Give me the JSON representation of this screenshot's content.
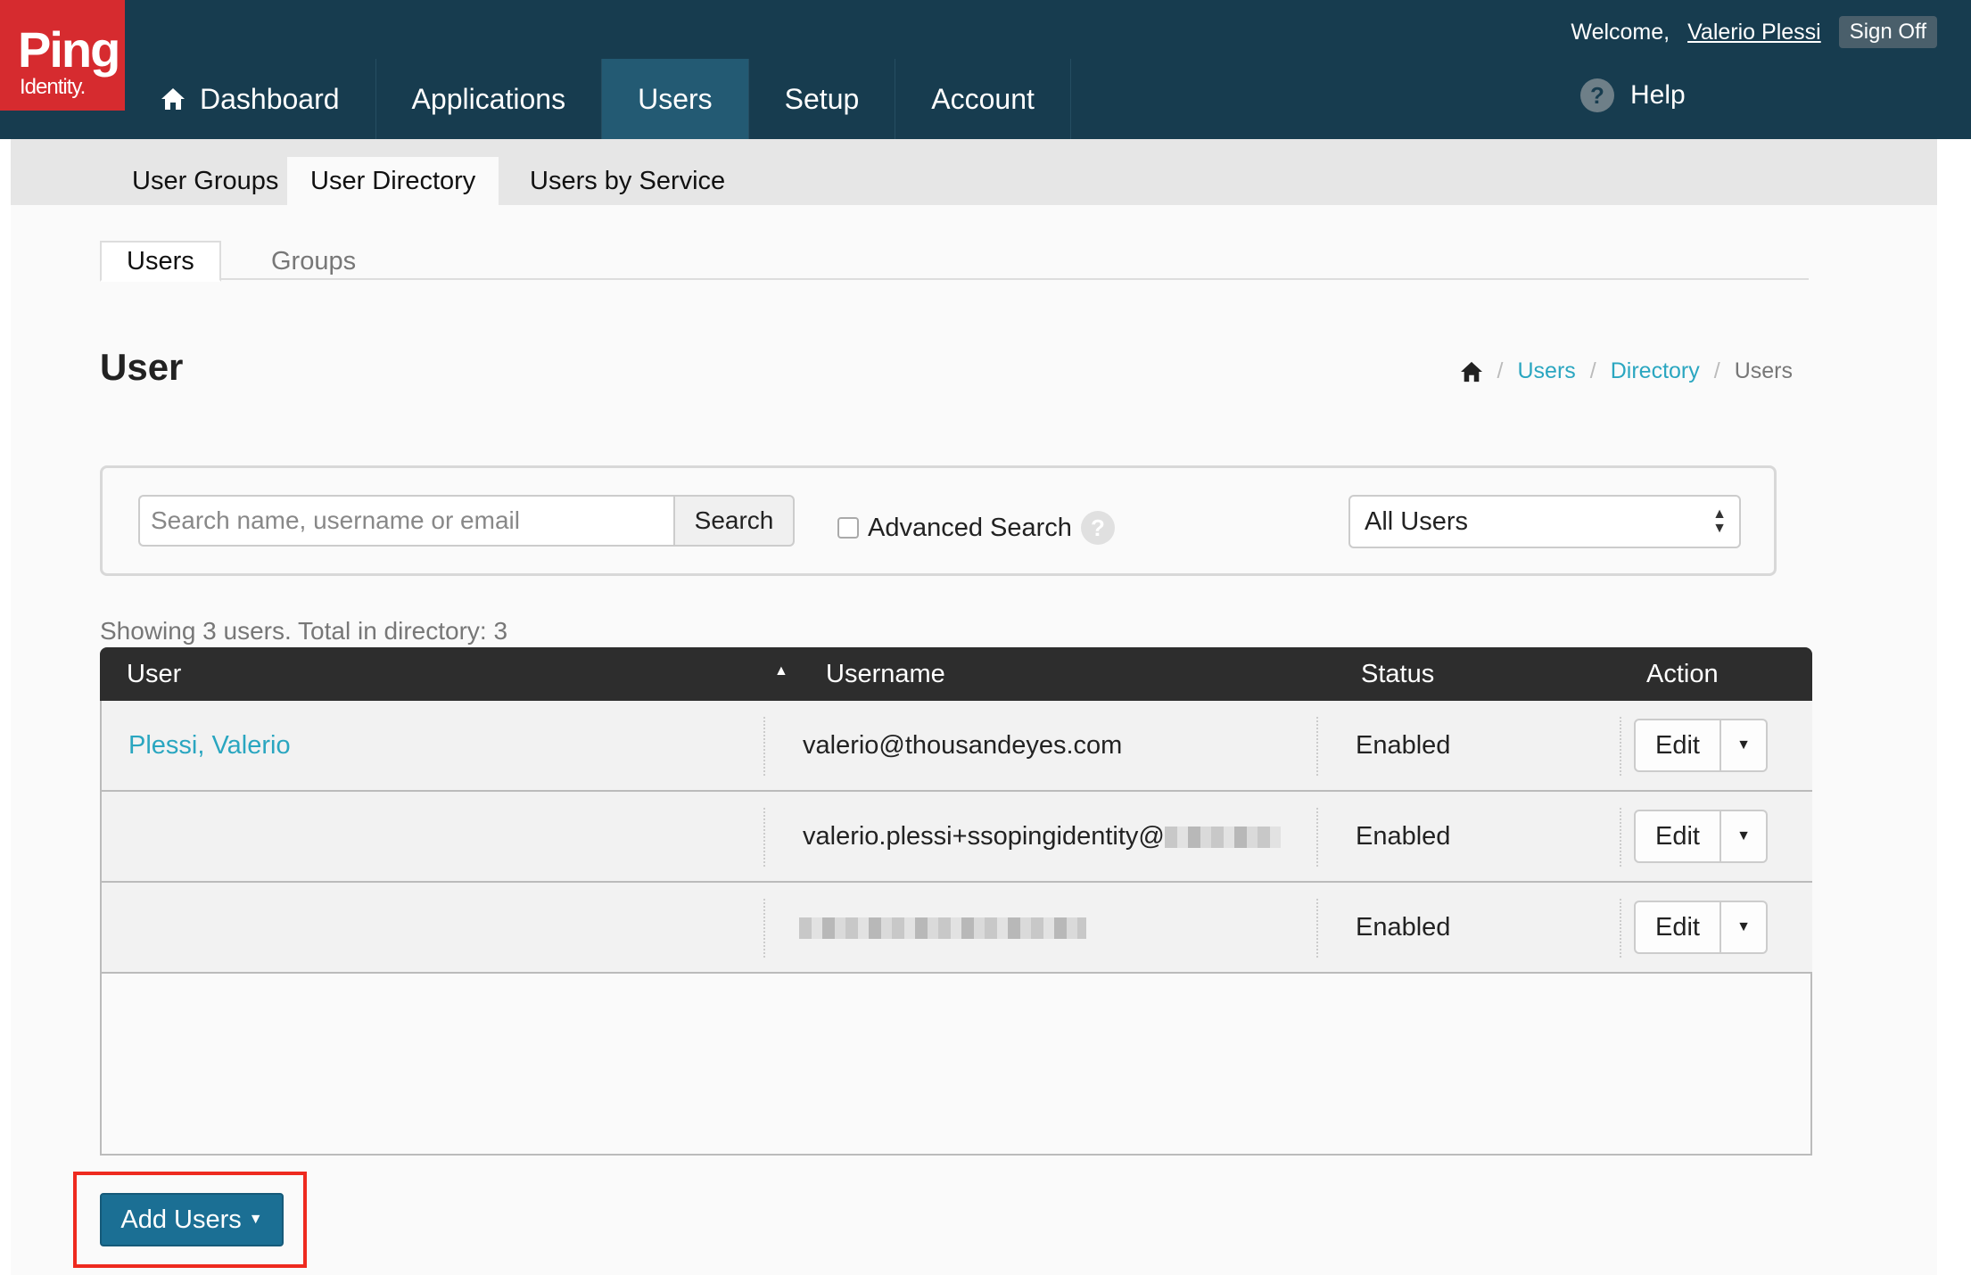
{
  "brand": {
    "name": "Ping",
    "sub": "Identity."
  },
  "topbar": {
    "welcome": "Welcome,",
    "username": "Valerio Plessi",
    "sign_off": "Sign Off"
  },
  "nav": {
    "items": [
      {
        "label": "Dashboard"
      },
      {
        "label": "Applications"
      },
      {
        "label": "Users"
      },
      {
        "label": "Setup"
      },
      {
        "label": "Account"
      }
    ],
    "active": "Users",
    "help_label": "Help"
  },
  "subnav": {
    "items": [
      {
        "label": "User Groups"
      },
      {
        "label": "User Directory"
      },
      {
        "label": "Users by Service"
      }
    ],
    "active": "User Directory"
  },
  "tabs": {
    "items": [
      {
        "label": "Users"
      },
      {
        "label": "Groups"
      }
    ],
    "active": "Users"
  },
  "page": {
    "title": "User"
  },
  "breadcrumb": {
    "items": [
      "Users",
      "Directory",
      "Users"
    ]
  },
  "search": {
    "placeholder": "Search name, username or email",
    "button": "Search",
    "advanced_label": "Advanced Search",
    "filter_value": "All Users"
  },
  "summary": {
    "text": "Showing 3 users. Total in directory: 3"
  },
  "table": {
    "headers": {
      "user": "User",
      "username": "Username",
      "status": "Status",
      "action": "Action"
    },
    "rows": [
      {
        "user": "Plessi, Valerio",
        "username": "valerio@thousandeyes.com",
        "status": "Enabled",
        "action": "Edit"
      },
      {
        "user": "",
        "username": "valerio.plessi+ssopingidentity@",
        "status": "Enabled",
        "action": "Edit"
      },
      {
        "user": "",
        "username": "",
        "status": "Enabled",
        "action": "Edit"
      }
    ]
  },
  "add_users": {
    "label": "Add Users"
  },
  "colors": {
    "header_bg": "#173c4f",
    "brand_red": "#d62b2f",
    "link": "#2aa6c0",
    "primary_button": "#1b6f94",
    "highlight": "#ee2a1f"
  }
}
